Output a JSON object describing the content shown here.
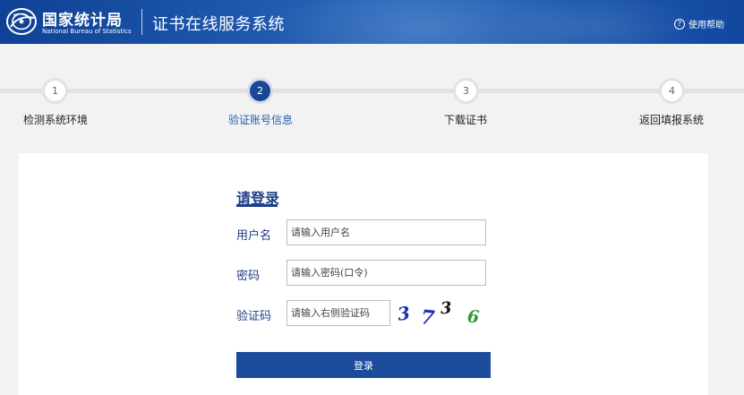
{
  "header": {
    "org_name_cn": "国家统计局",
    "org_name_en": "National Bureau of Statistics",
    "system_title": "证书在线服务系统",
    "help_label": "使用帮助",
    "help_icon": "question-circle-icon",
    "help_icon_glyph": "?",
    "logo_icon": "nbs-emblem-icon"
  },
  "steps": [
    {
      "number": "1",
      "label": "检测系统环境",
      "active": false
    },
    {
      "number": "2",
      "label": "验证账号信息",
      "active": true
    },
    {
      "number": "3",
      "label": "下载证书",
      "active": false
    },
    {
      "number": "4",
      "label": "返回填报系统",
      "active": false
    }
  ],
  "login": {
    "title": "请登录",
    "username_label": "用户名",
    "username_placeholder": "请输入用户名",
    "username_value": "",
    "password_label": "密码",
    "password_placeholder": "请输入密码(口令)",
    "password_value": "",
    "captcha_label": "验证码",
    "captcha_placeholder": "请输入右侧验证码",
    "captcha_value": "",
    "captcha_digits": [
      {
        "char": "3",
        "color": "#1f2fb0"
      },
      {
        "char": "7",
        "color": "#1f2fb0"
      },
      {
        "char": "3",
        "color": "#111111"
      },
      {
        "char": "6",
        "color": "#2f9a3a"
      }
    ],
    "submit_label": "登录"
  },
  "colors": {
    "header_blue": "#1c56aa",
    "accent_navy": "#1f3f86",
    "button_blue": "#1d4b9c",
    "active_step": "#1a4793",
    "active_step_label": "#2a5db0",
    "page_bg": "#f2f2f2"
  }
}
